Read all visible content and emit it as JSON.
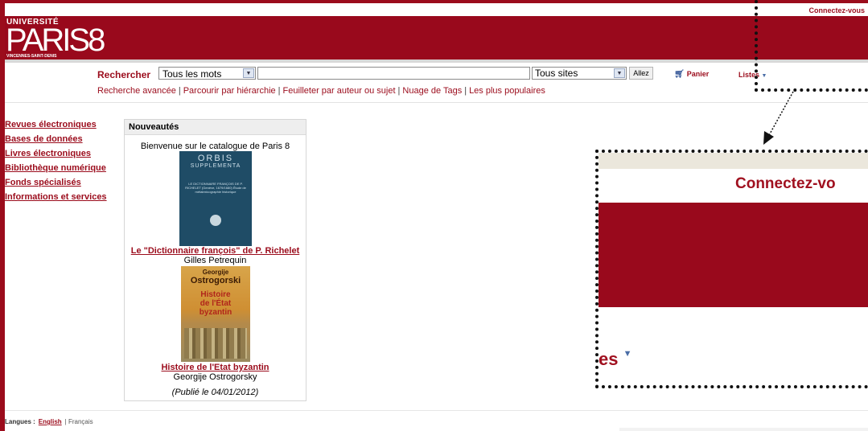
{
  "header": {
    "login": "Connectez-vous",
    "logo_univ": "UNIVERSITÉ",
    "logo_paris": "PARIS8",
    "logo_sub": "VINCENNES-SAINT-DENIS"
  },
  "search": {
    "label": "Rechercher",
    "scope_value": "Tous les mots",
    "query_value": "",
    "site_value": "Tous sites",
    "go_label": "Allez",
    "cart_label": "Panier",
    "lists_label": "Listes"
  },
  "sublinks": [
    "Recherche avancée",
    "Parcourir par hiérarchie",
    "Feuilleter par auteur ou sujet",
    "Nuage de Tags",
    "Les plus populaires"
  ],
  "nav": [
    "Revues électroniques",
    "Bases de données",
    "Livres électroniques",
    "Bibliothèque numérique",
    "Fonds spécialisés",
    "Informations et services"
  ],
  "news": {
    "heading": "Nouveautés",
    "welcome": "Bienvenue sur le catalogue de Paris 8",
    "books": [
      {
        "title": "Le \"Dictionnaire françois\" de P. Richelet",
        "author": "Gilles Petrequin",
        "cover_series": "ORBIS",
        "cover_sub": "SUPPLEMENTA",
        "cover_text": "LE DICTIONNAIRE FRANÇOIS DE P. RICHELET (Genève, 1679/1680) Étude de métalexicographie historique",
        "cover_color": "#1f4c66"
      },
      {
        "title": "Histoire de l'Etat byzantin",
        "author": "Georgije Ostrogorsky",
        "cover_author_first": "Georgije",
        "cover_author_last": "Ostrogorski",
        "cover_title_l1": "Histoire",
        "cover_title_l2": "de l'État",
        "cover_title_l3": "byzantin",
        "cover_color": "#cf8f33"
      }
    ],
    "published": "(Publié le 04/01/2012)"
  },
  "footer": {
    "langs_label": "Langues :",
    "english": "English",
    "french": "| Français"
  },
  "zoom": {
    "login": "Connectez-vo",
    "lists_fragment": "es"
  },
  "colors": {
    "brand_red": "#99091c",
    "link_red": "#9b0c1c"
  }
}
